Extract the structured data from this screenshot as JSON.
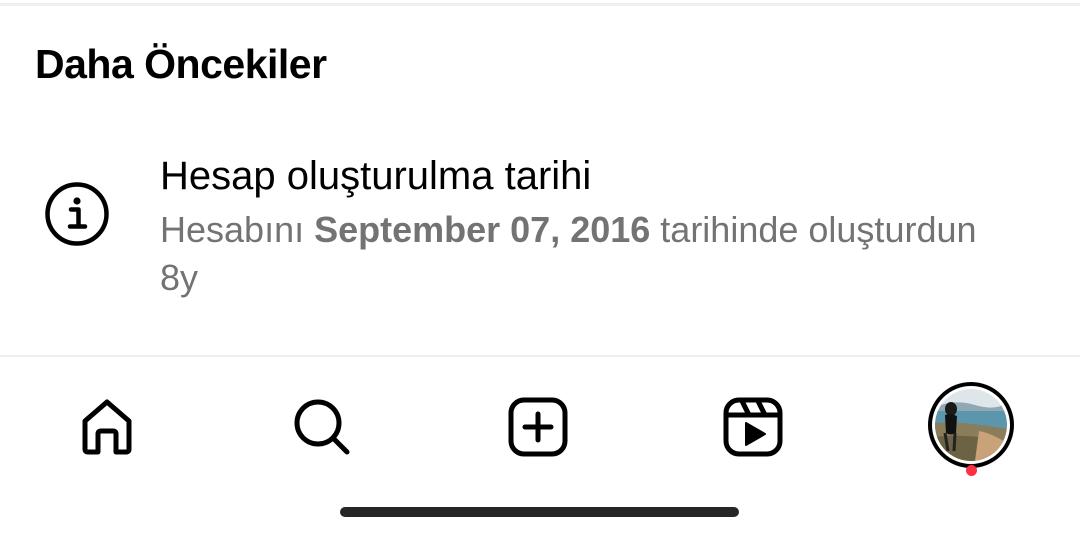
{
  "section": {
    "title": "Daha Öncekiler"
  },
  "activity": {
    "icon": "info-icon",
    "title": "Hesap oluşturulma tarihi",
    "desc_prefix": "Hesabını ",
    "desc_date": "September 07, 2016",
    "desc_suffix": " tarihinde oluşturdun",
    "time": "8y"
  },
  "nav": {
    "items": [
      {
        "id": "home",
        "icon": "home-icon"
      },
      {
        "id": "search",
        "icon": "search-icon"
      },
      {
        "id": "create",
        "icon": "plus-square-icon"
      },
      {
        "id": "reels",
        "icon": "reels-icon"
      },
      {
        "id": "profile",
        "icon": "avatar"
      }
    ],
    "notification_color": "#ff3040"
  },
  "colors": {
    "text_primary": "#000000",
    "text_secondary": "#737373",
    "divider": "#efefef",
    "home_indicator": "#262626"
  }
}
